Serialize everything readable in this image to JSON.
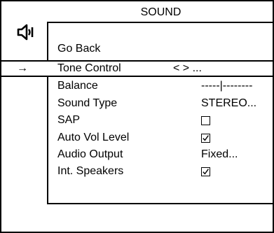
{
  "header": {
    "title": "SOUND",
    "icon": "speaker-icon"
  },
  "menu": {
    "cursor_symbol": "→",
    "items": [
      {
        "label": "Go Back",
        "value": ""
      },
      {
        "label": "Tone Control",
        "value": "< > ...",
        "selected": true
      },
      {
        "label": "Balance",
        "value": "-----|--------"
      },
      {
        "label": "Sound Type",
        "value": "STEREO..."
      },
      {
        "label": "SAP",
        "checked": false
      },
      {
        "label": "Auto Vol Level",
        "checked": true
      },
      {
        "label": "Audio Output",
        "value": "Fixed..."
      },
      {
        "label": "Int. Speakers",
        "checked": true
      }
    ]
  }
}
